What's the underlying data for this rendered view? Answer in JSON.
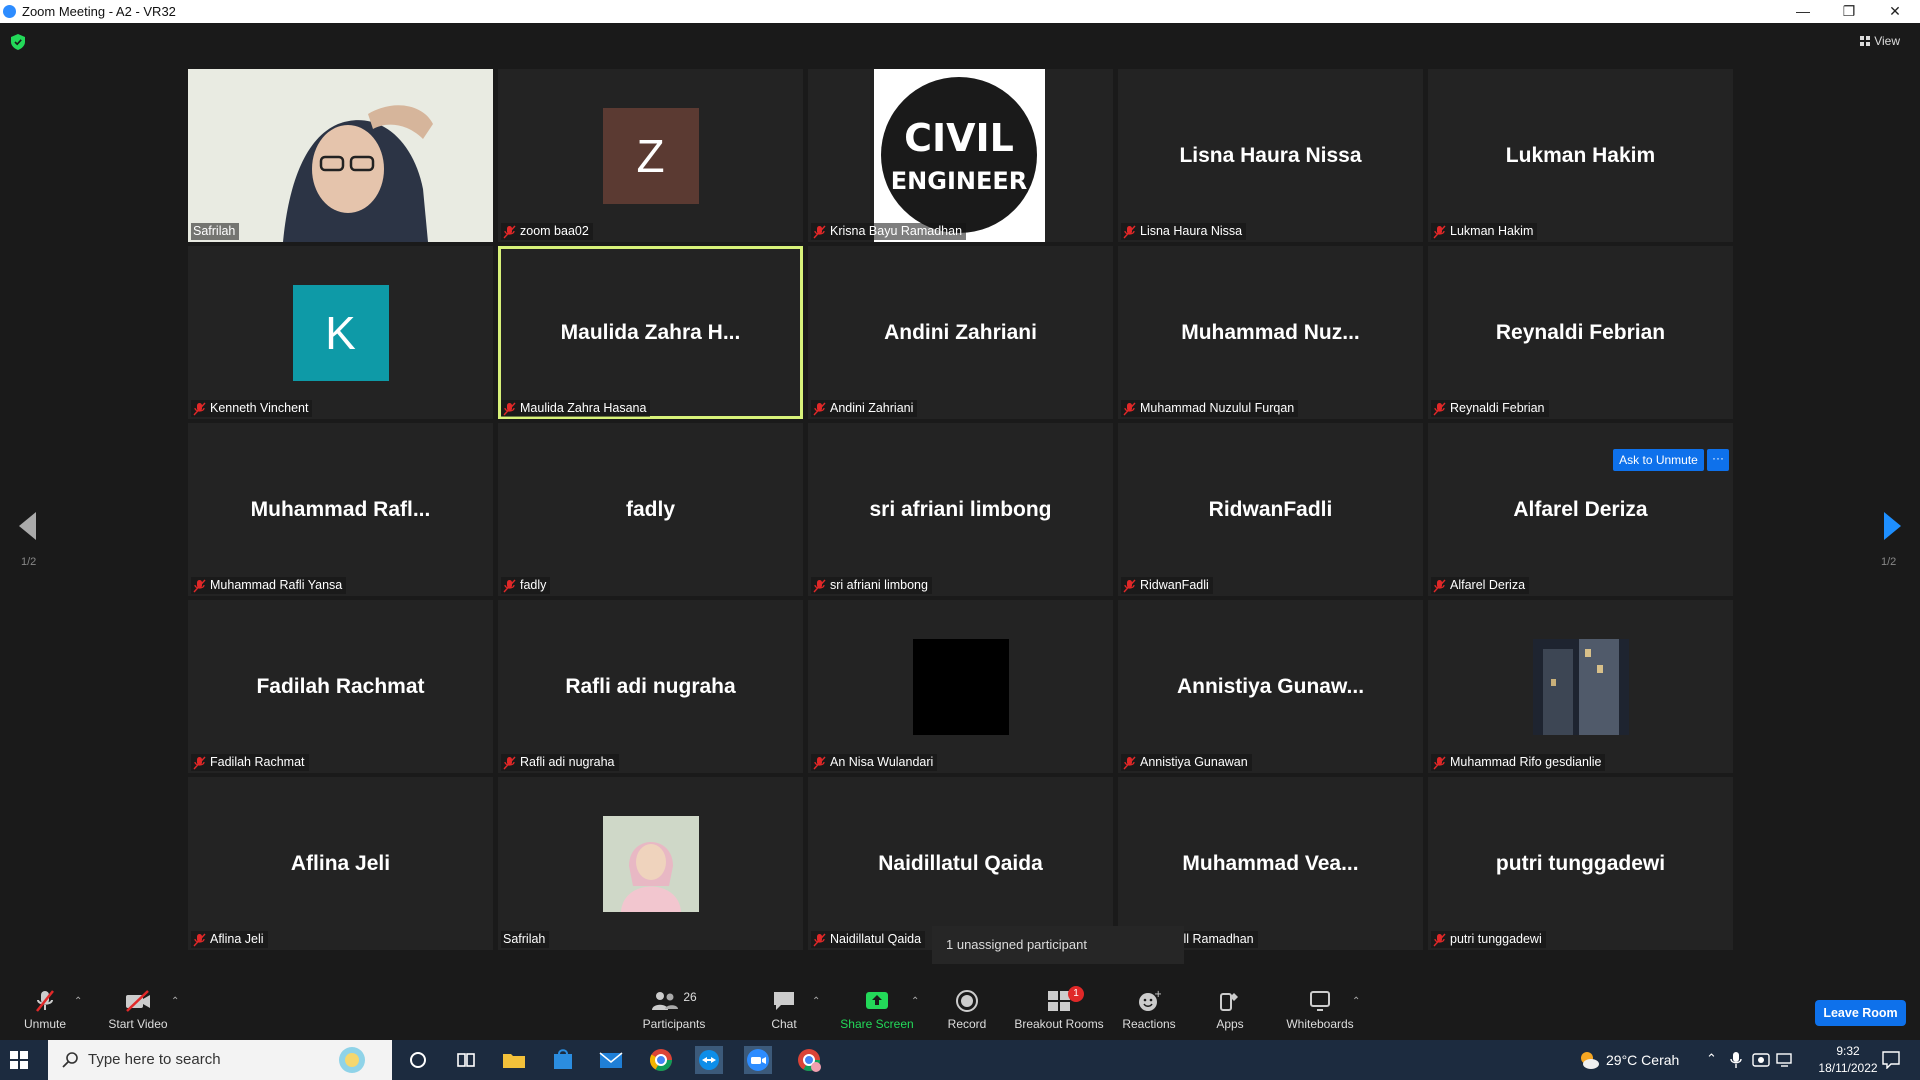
{
  "window": {
    "title": "Zoom Meeting - A2 - VR32"
  },
  "header": {
    "view_label": "View"
  },
  "pager": {
    "left": "1/2",
    "right": "1/2"
  },
  "tiles": [
    {
      "center": "",
      "label": "Safrilah",
      "muted": false,
      "kind": "video"
    },
    {
      "center": "",
      "label": "zoom baa02",
      "muted": true,
      "kind": "letter",
      "letter": "Z",
      "color": "#5b3a32"
    },
    {
      "center": "",
      "label": "Krisna Bayu Ramadhan",
      "muted": true,
      "kind": "logo",
      "logo_line1": "CIVIL",
      "logo_line2": "ENGINEER"
    },
    {
      "center": "Lisna Haura Nissa",
      "label": "Lisna Haura Nissa",
      "muted": true
    },
    {
      "center": "Lukman Hakim",
      "label": "Lukman Hakim",
      "muted": true
    },
    {
      "center": "",
      "label": "Kenneth Vinchent",
      "muted": true,
      "kind": "letter",
      "letter": "K",
      "color": "#0e9aa7"
    },
    {
      "center": "Maulida  Zahra  H...",
      "label": "Maulida Zahra Hasana",
      "muted": true,
      "active": true
    },
    {
      "center": "Andini Zahriani",
      "label": "Andini Zahriani",
      "muted": true
    },
    {
      "center": "Muhammad  Nuz...",
      "label": "Muhammad Nuzulul Furqan",
      "muted": true
    },
    {
      "center": "Reynaldi Febrian",
      "label": "Reynaldi Febrian",
      "muted": true
    },
    {
      "center": "Muhammad  Rafl...",
      "label": "Muhammad Rafli Yansa",
      "muted": true
    },
    {
      "center": "fadly",
      "label": "fadly",
      "muted": true
    },
    {
      "center": "sri afriani limbong",
      "label": "sri afriani limbong",
      "muted": true
    },
    {
      "center": "RidwanFadli",
      "label": "RidwanFadli",
      "muted": true
    },
    {
      "center": "Alfarel Deriza",
      "label": "Alfarel Deriza",
      "muted": true
    },
    {
      "center": "Fadilah Rachmat",
      "label": "Fadilah Rachmat",
      "muted": true
    },
    {
      "center": "Rafli adi nugraha",
      "label": "Rafli adi nugraha",
      "muted": true
    },
    {
      "center": "",
      "label": "An Nisa Wulandari",
      "muted": true,
      "kind": "black"
    },
    {
      "center": "Annistiya  Gunaw...",
      "label": "Annistiya Gunawan",
      "muted": true
    },
    {
      "center": "",
      "label": "Muhammad Rifo gesdianlie",
      "muted": true,
      "kind": "photo-building"
    },
    {
      "center": "Aflina Jeli",
      "label": "Aflina Jeli",
      "muted": true
    },
    {
      "center": "",
      "label": "Safrilah",
      "muted": false,
      "kind": "photo-person"
    },
    {
      "center": "Naidillatul Qaida",
      "label": "Naidillatul Qaida",
      "muted": true
    },
    {
      "center": "Muhammad  Vea...",
      "label": "mad Vearell Ramadhan",
      "muted": false
    },
    {
      "center": "putri tunggadewi",
      "label": "putri tunggadewi",
      "muted": true
    }
  ],
  "hover_controls": {
    "ask_to_unmute": "Ask to Unmute",
    "more": "···"
  },
  "tooltip": "1 unassigned participant",
  "toolbar": {
    "unmute": "Unmute",
    "start_video": "Start Video",
    "participants": "Participants",
    "participants_count": "26",
    "chat": "Chat",
    "share_screen": "Share Screen",
    "record": "Record",
    "breakout_rooms": "Breakout Rooms",
    "breakout_badge": "1",
    "reactions": "Reactions",
    "apps": "Apps",
    "whiteboards": "Whiteboards",
    "leave_room": "Leave Room"
  },
  "taskbar": {
    "search_placeholder": "Type here to search",
    "weather": "29°C  Cerah",
    "time": "9:32",
    "date": "18/11/2022"
  },
  "colors": {
    "accent": "#0e71eb",
    "active_speaker": "#d8f27a",
    "tile_bg": "#232323",
    "share_green": "#23d959",
    "badge_red": "#e02828"
  }
}
